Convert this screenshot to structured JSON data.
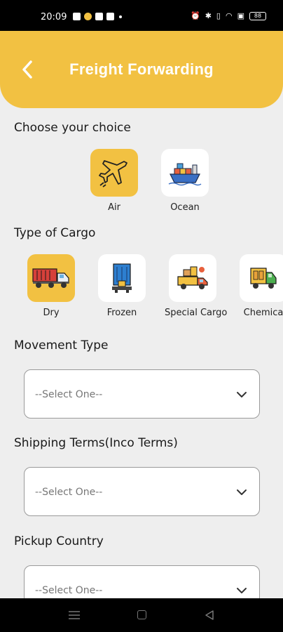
{
  "status_bar": {
    "time": "20:09",
    "battery": "88"
  },
  "header": {
    "title": "Freight Forwarding"
  },
  "choice": {
    "title": "Choose your choice",
    "items": [
      {
        "label": "Air",
        "icon": "airplane-icon",
        "selected": true
      },
      {
        "label": "Ocean",
        "icon": "cargo-ship-icon",
        "selected": false
      }
    ]
  },
  "cargo": {
    "title": "Type of Cargo",
    "items": [
      {
        "label": "Dry",
        "icon": "truck-icon",
        "selected": true
      },
      {
        "label": "Frozen",
        "icon": "refrigerated-container-icon",
        "selected": false
      },
      {
        "label": "Special Cargo",
        "icon": "delivery-truck-icon",
        "selected": false
      },
      {
        "label": "Chemica",
        "icon": "chemical-truck-icon",
        "selected": false
      }
    ]
  },
  "movement": {
    "title": "Movement Type",
    "value": "--Select One--"
  },
  "shipping_terms": {
    "title": "Shipping Terms(Inco Terms)",
    "value": "--Select One--"
  },
  "pickup_country": {
    "title": "Pickup Country",
    "value": "--Select One--"
  },
  "colors": {
    "accent": "#f2c142",
    "background": "#eeeeee",
    "tile": "#ffffff"
  }
}
